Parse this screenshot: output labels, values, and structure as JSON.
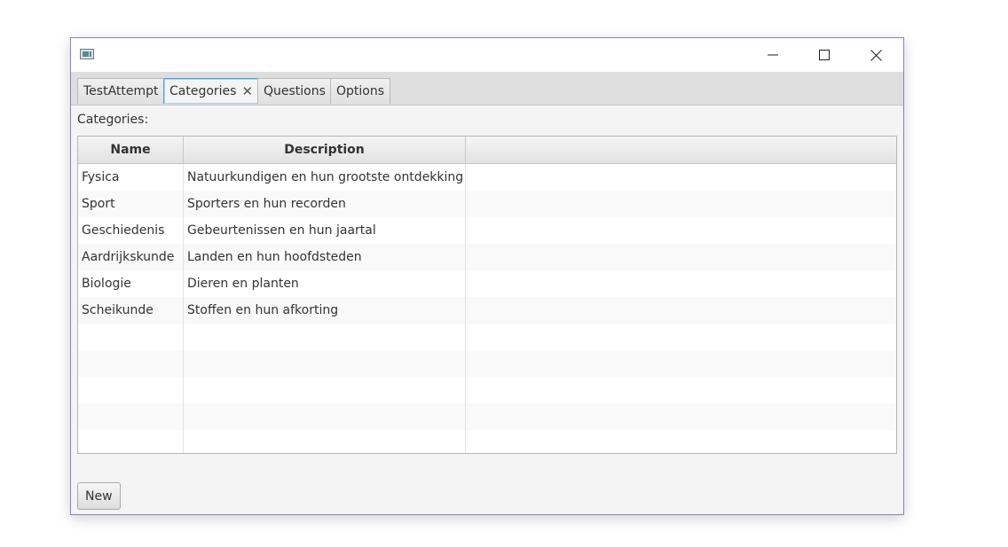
{
  "window": {
    "title": "",
    "controls": {
      "minimize_icon": "minimize-icon",
      "maximize_icon": "maximize-icon",
      "close_icon": "close-icon"
    }
  },
  "tabs": [
    {
      "label": "TestAttempt",
      "selected": false,
      "closable": false
    },
    {
      "label": "Categories",
      "selected": true,
      "closable": true,
      "close_glyph": "✕"
    },
    {
      "label": "Questions",
      "selected": false,
      "closable": false
    },
    {
      "label": "Options",
      "selected": false,
      "closable": false
    }
  ],
  "content": {
    "label": "Categories:",
    "table": {
      "columns": [
        "Name",
        "Description",
        ""
      ],
      "rows": [
        [
          "Fysica",
          "Natuurkundigen en hun grootste ontdekking"
        ],
        [
          "Sport",
          "Sporters en hun recorden"
        ],
        [
          "Geschiedenis",
          "Gebeurtenissen en hun jaartal"
        ],
        [
          "Aardrijkskunde",
          "Landen en hun hoofdsteden"
        ],
        [
          "Biologie",
          "Dieren en planten"
        ],
        [
          "Scheikunde",
          "Stoffen en hun afkorting"
        ],
        [
          "",
          ""
        ],
        [
          "",
          ""
        ],
        [
          "",
          ""
        ],
        [
          "",
          ""
        ],
        [
          "",
          ""
        ]
      ]
    },
    "new_button": "New"
  },
  "colors": {
    "window_border": "#8a7fcf",
    "selected_tab_border": "#4fa3d9",
    "content_background": "#f4f4f4"
  }
}
